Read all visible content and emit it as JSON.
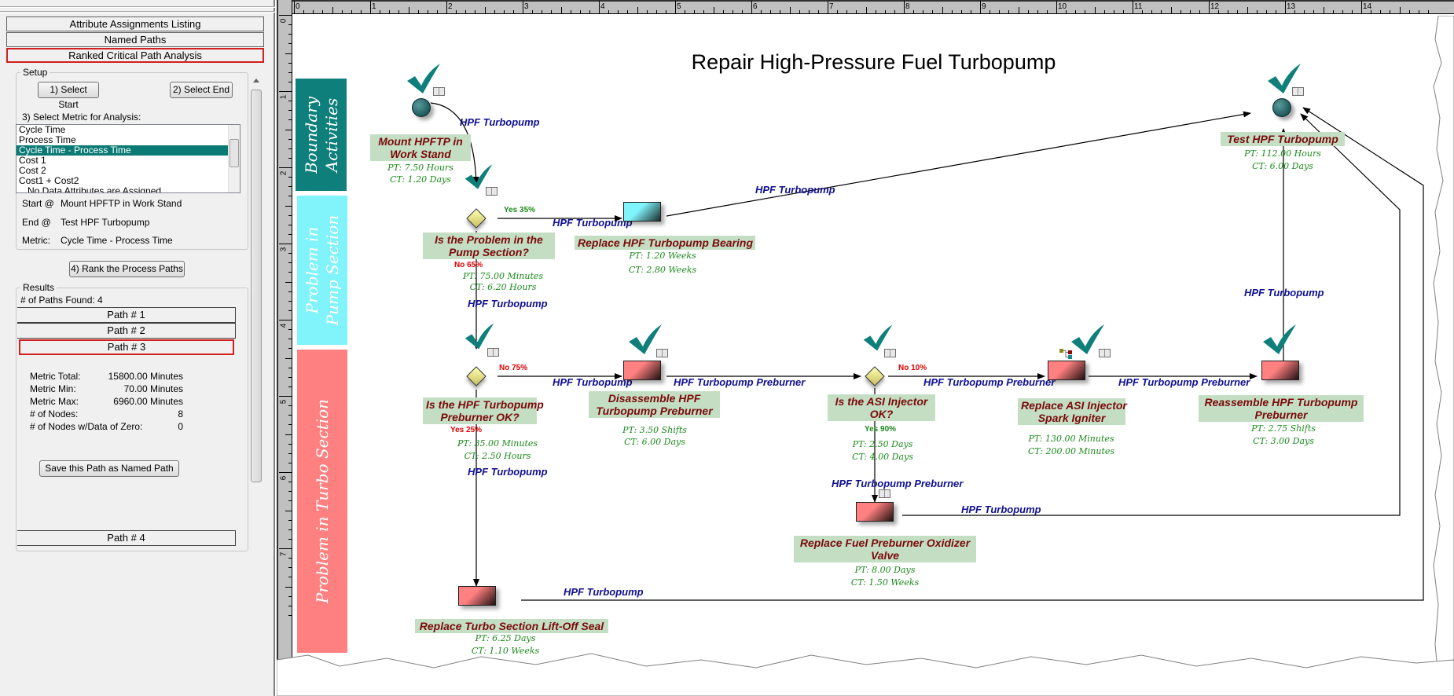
{
  "left_panel": {
    "tabs": [
      {
        "label": "Attribute Assignments Listing",
        "active": false
      },
      {
        "label": "Named Paths",
        "active": false
      },
      {
        "label": "Ranked Critical Path Analysis",
        "active": true
      }
    ],
    "setup": {
      "legend": "Setup",
      "select_start_label": "1) Select Start",
      "select_end_label": "2) Select End",
      "metric_prompt": "3) Select Metric for Analysis:",
      "metric_options": [
        "Cycle Time",
        "Process Time",
        "Cycle Time - Process Time",
        "Cost 1",
        "Cost 2",
        "Cost1 + Cost2",
        "No Data Attributes are Assigned"
      ],
      "selected_metric": "Cycle Time - Process Time",
      "start_label": "Start @",
      "start_value": "Mount HPFTP in Work Stand",
      "end_label": "End @",
      "end_value": "Test HPF Turbopump",
      "metric_label": "Metric:",
      "metric_value": "Cycle Time - Process Time"
    },
    "rank_button_label": "4) Rank the Process Paths",
    "results": {
      "legend": "Results",
      "paths_found_label": "# of Paths Found:",
      "paths_found_value": "4",
      "paths": [
        {
          "label": "Path # 1",
          "active": false
        },
        {
          "label": "Path # 2",
          "active": false
        },
        {
          "label": "Path # 3",
          "active": true
        },
        {
          "label": "Path # 4",
          "active": false
        }
      ],
      "stats": [
        {
          "label": "Metric Total:",
          "value": "15800.00 Minutes"
        },
        {
          "label": "Metric Min:",
          "value": "70.00 Minutes"
        },
        {
          "label": "Metric Max:",
          "value": "6960.00 Minutes"
        },
        {
          "label": "# of Nodes:",
          "value": "8"
        },
        {
          "label": "# of Nodes w/Data of Zero:",
          "value": "0"
        }
      ],
      "save_button_label": "Save this Path as Named Path"
    }
  },
  "canvas": {
    "ruler_top_numbers": [
      "0",
      "1",
      "2",
      "3",
      "4",
      "5",
      "6",
      "7",
      "8",
      "9",
      "10",
      "11",
      "12",
      "13",
      "14"
    ],
    "ruler_left_numbers": [
      "0",
      "1",
      "2",
      "3",
      "4",
      "5",
      "6",
      "7"
    ],
    "title": "Repair High-Pressure Fuel Turbopump",
    "lanes": [
      {
        "label": "Boundary Activities",
        "color": "#0e7f7a"
      },
      {
        "label": "Problem in Pump Section",
        "color": "#80f3fb"
      },
      {
        "label": "Problem in Turbo Section",
        "color": "#ff8080"
      }
    ],
    "nodes": [
      {
        "id": "mount",
        "type": "start",
        "label_lines": [
          "Mount HPFTP in",
          "Work Stand"
        ],
        "pt": "PT:  7.50 Hours",
        "ct": "CT: 1.20 Days",
        "checked": true
      },
      {
        "id": "pump-q",
        "type": "decision",
        "label_lines": [
          "Is the Problem in the",
          "Pump Section?"
        ],
        "pt": "PT:  75.00 Minutes",
        "ct": "CT: 6.20 Hours",
        "checked": true,
        "yes": "Yes  35%",
        "no": "No   65%"
      },
      {
        "id": "bearing",
        "type": "task-cyan",
        "label_lines": [
          "Replace HPF Turbopump Bearing"
        ],
        "pt": "PT:  1.20 Weeks",
        "ct": "CT: 2.80 Weeks",
        "checked": false
      },
      {
        "id": "test",
        "type": "end",
        "label_lines": [
          "Test HPF Turbopump"
        ],
        "pt": "PT:  112.00 Hours",
        "ct": "CT: 6.00 Days",
        "checked": true
      },
      {
        "id": "preburner-q",
        "type": "decision",
        "label_lines": [
          "Is the HPF Turbopump",
          "Preburner OK?"
        ],
        "pt": "PT:  35.00 Minutes",
        "ct": "CT: 2.50 Hours",
        "checked": true,
        "yes": "Yes  25%",
        "no": "No  75%"
      },
      {
        "id": "disassemble",
        "type": "task-pink",
        "label_lines": [
          "Disassemble HPF",
          "Turbopump Preburner"
        ],
        "pt": "PT:  3.50 Shifts",
        "ct": "CT: 6.00 Days",
        "checked": true
      },
      {
        "id": "asi-q",
        "type": "decision",
        "label_lines": [
          "Is the ASI Injector",
          "OK?"
        ],
        "pt": "PT:  2.50 Days",
        "ct": "CT: 4.00 Days",
        "checked": true,
        "yes": "Yes  90%",
        "no": "No   10%"
      },
      {
        "id": "asi-replace",
        "type": "task-pink",
        "label_lines": [
          "Replace ASI Injector",
          "Spark Igniter"
        ],
        "pt": "PT:  130.00 Minutes",
        "ct": "CT: 200.00 Minutes",
        "checked": true
      },
      {
        "id": "reassemble",
        "type": "task-pink",
        "label_lines": [
          "Reassemble HPF Turbopump",
          "Preburner"
        ],
        "pt": "PT:  2.75 Shifts",
        "ct": "CT: 3.00 Days",
        "checked": true
      },
      {
        "id": "oxidizer",
        "type": "task-pink",
        "label_lines": [
          "Replace Fuel Preburner Oxidizer",
          "Valve"
        ],
        "pt": "PT:  8.00 Days",
        "ct": "CT: 1.50 Weeks",
        "checked": false
      },
      {
        "id": "liftoff",
        "type": "task-pink",
        "label_lines": [
          "Replace Turbo Section Lift-Off Seal"
        ],
        "pt": "PT:  6.25 Days",
        "ct": "CT: 1.10 Weeks",
        "checked": false
      }
    ],
    "edge_labels": {
      "mount_to_pumpq": "HPF Turbopump",
      "pumpq_to_bearing": "HPF Turbopump",
      "bearing_to_test": "HPF Turbopump",
      "pumpq_to_preburnerq": "HPF Turbopump",
      "preburnerq_to_disassemble": "HPF Turbopump",
      "disassemble_to_asiq": "HPF Turbopump Preburner",
      "asiq_to_asireplace": "HPF Turbopump Preburner",
      "asireplace_to_reassemble": "HPF Turbopump Preburner",
      "reassemble_to_test": "HPF Turbopump",
      "asiq_to_oxidizer": "HPF Turbopump Preburner",
      "oxidizer_to_test": "HPF Turbopump",
      "preburnerq_to_liftoff": "HPF Turbopump",
      "liftoff_to_test": "HPF Turbopump"
    }
  }
}
